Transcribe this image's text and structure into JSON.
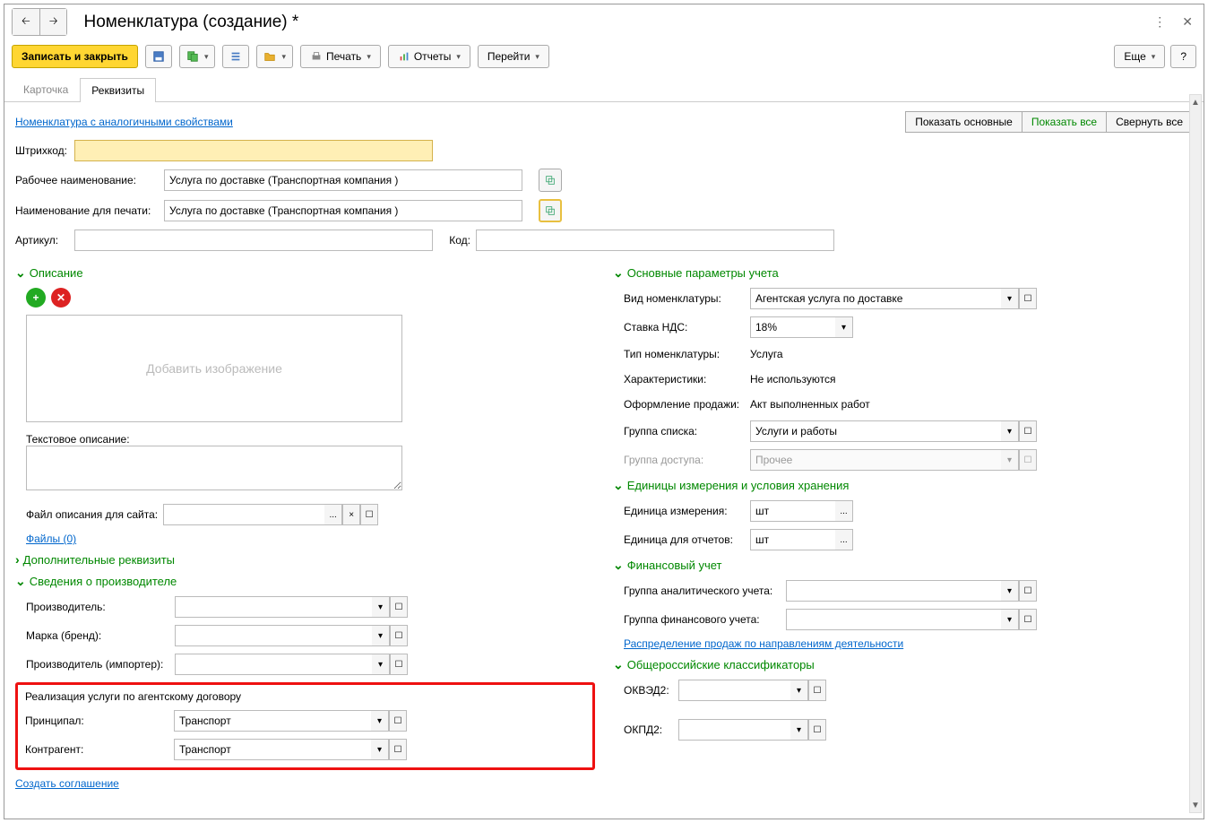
{
  "title": "Номенклатура (создание) *",
  "toolbar": {
    "save_close": "Записать и закрыть",
    "print": "Печать",
    "reports": "Отчеты",
    "goto": "Перейти",
    "more": "Еще",
    "help": "?"
  },
  "tabs": {
    "card": "Карточка",
    "props": "Реквизиты"
  },
  "links": {
    "similar": "Номенклатура с аналогичными свойствами",
    "files": "Файлы (0)",
    "distribution": "Распределение продаж по направлениям деятельности",
    "create_agreement": "Создать соглашение"
  },
  "view": {
    "main": "Показать основные",
    "all": "Показать все",
    "collapse": "Свернуть все"
  },
  "fields": {
    "barcode": "Штрихкод:",
    "work_name": "Рабочее наименование:",
    "work_name_val": "Услуга по доставке (Транспортная компания )",
    "print_name": "Наименование для печати:",
    "print_name_val": "Услуга по доставке (Транспортная компания )",
    "article": "Артикул:",
    "code": "Код:"
  },
  "sections": {
    "description": "Описание",
    "main_params": "Основные параметры учета",
    "units": "Единицы измерения и условия хранения",
    "finance": "Финансовый учет",
    "classifiers": "Общероссийские классификаторы",
    "extra": "Дополнительные реквизиты",
    "manufacturer": "Сведения о производителе"
  },
  "desc": {
    "add_image": "Добавить изображение",
    "text_desc": "Текстовое описание:",
    "site_file": "Файл описания для сайта:"
  },
  "manufacturer": {
    "producer": "Производитель:",
    "brand": "Марка (бренд):",
    "importer": "Производитель (импортер):"
  },
  "agency": {
    "title": "Реализация услуги по агентскому договору",
    "principal": "Принципал:",
    "principal_val": "Транспорт",
    "counterparty": "Контрагент:",
    "counterparty_val": "Транспорт"
  },
  "params": {
    "kind": "Вид номенклатуры:",
    "kind_val": "Агентская услуга по доставке",
    "vat": "Ставка НДС:",
    "vat_val": "18%",
    "type": "Тип номенклатуры:",
    "type_val": "Услуга",
    "chars": "Характеристики:",
    "chars_val": "Не используются",
    "sale": "Оформление продажи:",
    "sale_val": "Акт выполненных работ",
    "list_group": "Группа списка:",
    "list_group_val": "Услуги и работы",
    "access_group": "Группа доступа:",
    "access_group_val": "Прочее"
  },
  "units": {
    "unit": "Единица измерения:",
    "unit_val": "шт",
    "report_unit": "Единица для отчетов:",
    "report_unit_val": "шт"
  },
  "finance": {
    "analytic": "Группа аналитического учета:",
    "fingroup": "Группа финансового учета:"
  },
  "classifiers": {
    "okved": "ОКВЭД2:",
    "okpd": "ОКПД2:"
  }
}
